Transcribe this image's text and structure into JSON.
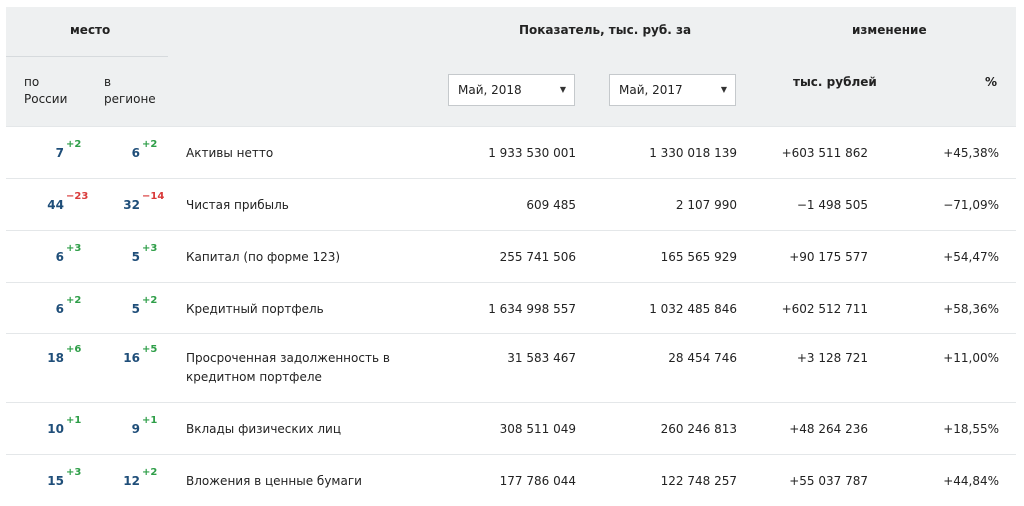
{
  "header": {
    "place": "место",
    "russia_label": "по\nРоссии",
    "region_label": "в\nрегионе",
    "indicator_title": "Показатель, тыс. руб. за",
    "change_title": "изменение",
    "thousand_rubles": "тыс. рублей",
    "percent": "%",
    "select1": "Май, 2018",
    "select2": "Май, 2017"
  },
  "colors": {
    "positive": "#2e9e48",
    "negative": "#d93a3a",
    "rank": "#1f4e79",
    "header_bg": "#eef0f1"
  },
  "rows": [
    {
      "rank_ru": "7",
      "rank_ru_delta": "+2",
      "rank_reg": "6",
      "rank_reg_delta": "+2",
      "name": "Активы нетто",
      "val2018": "1 933 530 001",
      "val2017": "1 330 018 139",
      "change": "+603 511 862",
      "change_pct": "+45,38%",
      "sign": "pos"
    },
    {
      "rank_ru": "44",
      "rank_ru_delta": "−23",
      "rank_reg": "32",
      "rank_reg_delta": "−14",
      "name": "Чистая прибыль",
      "val2018": "609 485",
      "val2017": "2 107 990",
      "change": "−1 498 505",
      "change_pct": "−71,09%",
      "sign": "neg"
    },
    {
      "rank_ru": "6",
      "rank_ru_delta": "+3",
      "rank_reg": "5",
      "rank_reg_delta": "+3",
      "name": "Капитал (по форме 123)",
      "val2018": "255 741 506",
      "val2017": "165 565 929",
      "change": "+90 175 577",
      "change_pct": "+54,47%",
      "sign": "pos"
    },
    {
      "rank_ru": "6",
      "rank_ru_delta": "+2",
      "rank_reg": "5",
      "rank_reg_delta": "+2",
      "name": "Кредитный портфель",
      "val2018": "1 634 998 557",
      "val2017": "1 032 485 846",
      "change": "+602 512 711",
      "change_pct": "+58,36%",
      "sign": "pos"
    },
    {
      "rank_ru": "18",
      "rank_ru_delta": "+6",
      "rank_reg": "16",
      "rank_reg_delta": "+5",
      "name": "Просроченная задолженность в\nкредитном портфеле",
      "val2018": "31 583 467",
      "val2017": "28 454 746",
      "change": "+3 128 721",
      "change_pct": "+11,00%",
      "sign": "pos"
    },
    {
      "rank_ru": "10",
      "rank_ru_delta": "+1",
      "rank_reg": "9",
      "rank_reg_delta": "+1",
      "name": "Вклады физических лиц",
      "val2018": "308 511 049",
      "val2017": "260 246 813",
      "change": "+48 264 236",
      "change_pct": "+18,55%",
      "sign": "pos"
    },
    {
      "rank_ru": "15",
      "rank_ru_delta": "+3",
      "rank_reg": "12",
      "rank_reg_delta": "+2",
      "name": "Вложения в ценные бумаги",
      "val2018": "177 786 044",
      "val2017": "122 748 257",
      "change": "+55 037 787",
      "change_pct": "+44,84%",
      "sign": "pos"
    }
  ]
}
